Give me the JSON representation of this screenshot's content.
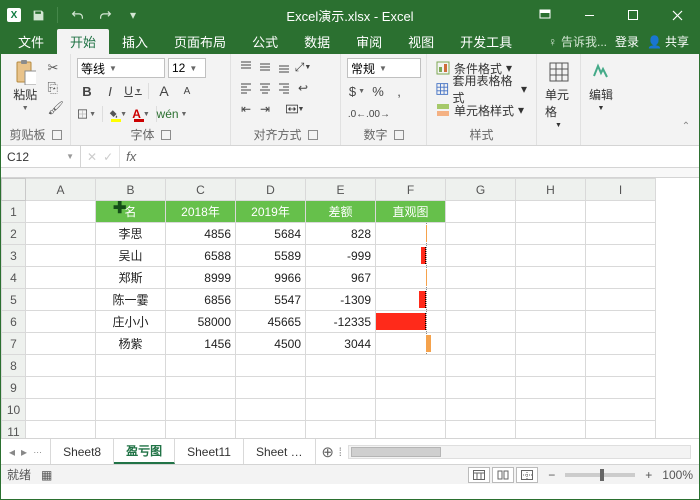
{
  "window": {
    "title": "Excel演示.xlsx - Excel"
  },
  "qat": {
    "app_initial": "X"
  },
  "tabs": {
    "file": "文件",
    "home": "开始",
    "insert": "插入",
    "layout": "页面布局",
    "formulas": "公式",
    "data": "数据",
    "review": "审阅",
    "view": "视图",
    "dev": "开发工具",
    "tellme": "告诉我...",
    "signin": "登录",
    "share": "共享"
  },
  "ribbon": {
    "clipboard": {
      "paste": "粘贴",
      "label": "剪贴板"
    },
    "font": {
      "name": "等线",
      "size": "12",
      "label": "字体",
      "B": "B",
      "I": "I",
      "U": "U",
      "A_up": "A",
      "A_dn": "A",
      "wen": "wén"
    },
    "align": {
      "label": "对齐方式"
    },
    "number": {
      "format": "常规",
      "label": "数字"
    },
    "styles": {
      "cond": "条件格式",
      "tbl": "套用表格格式",
      "cell": "单元格样式",
      "label": "样式"
    },
    "cells": {
      "label": "单元格"
    },
    "editing": {
      "label": "编辑"
    }
  },
  "namebox": {
    "ref": "C12",
    "fx": "fx"
  },
  "columns": [
    "A",
    "B",
    "C",
    "D",
    "E",
    "F",
    "G",
    "H",
    "I"
  ],
  "rows": [
    "1",
    "2",
    "3",
    "4",
    "5",
    "6",
    "7",
    "8",
    "9",
    "10",
    "11"
  ],
  "headers": {
    "b": "名",
    "c": "2018年",
    "d": "2019年",
    "e": "差额",
    "f": "直观图"
  },
  "data": [
    {
      "name": "李思",
      "y18": "4856",
      "y19": "5684",
      "diff": "828",
      "barPct": 8,
      "pos": true
    },
    {
      "name": "吴山",
      "y18": "6588",
      "y19": "5589",
      "diff": "-999",
      "barPct": 10,
      "pos": false
    },
    {
      "name": "郑斯",
      "y18": "8999",
      "y19": "9966",
      "diff": "967",
      "barPct": 9,
      "pos": true
    },
    {
      "name": "陈一霎",
      "y18": "6856",
      "y19": "5547",
      "diff": "-1309",
      "barPct": 13,
      "pos": false
    },
    {
      "name": "庄小小",
      "y18": "58000",
      "y19": "45665",
      "diff": "-12335",
      "barPct": 100,
      "pos": false
    },
    {
      "name": "杨紫",
      "y18": "1456",
      "y19": "4500",
      "diff": "3044",
      "barPct": 28,
      "pos": true
    }
  ],
  "sheets": {
    "s1": "Sheet8",
    "s2": "盈亏图",
    "s3": "Sheet11",
    "s4": "Sheet"
  },
  "status": {
    "ready": "就绪",
    "zoom": "100%"
  },
  "chart_data": {
    "type": "bar",
    "title": "差额 直观图",
    "categories": [
      "李思",
      "吴山",
      "郑斯",
      "陈一霎",
      "庄小小",
      "杨紫"
    ],
    "series": [
      {
        "name": "2018年",
        "values": [
          4856,
          6588,
          8999,
          6856,
          58000,
          1456
        ]
      },
      {
        "name": "2019年",
        "values": [
          5684,
          5589,
          9966,
          5547,
          45665,
          4500
        ]
      },
      {
        "name": "差额",
        "values": [
          828,
          -999,
          967,
          -1309,
          -12335,
          3044
        ]
      }
    ],
    "xlabel": "",
    "ylabel": "",
    "ylim": [
      -13000,
      4000
    ]
  }
}
